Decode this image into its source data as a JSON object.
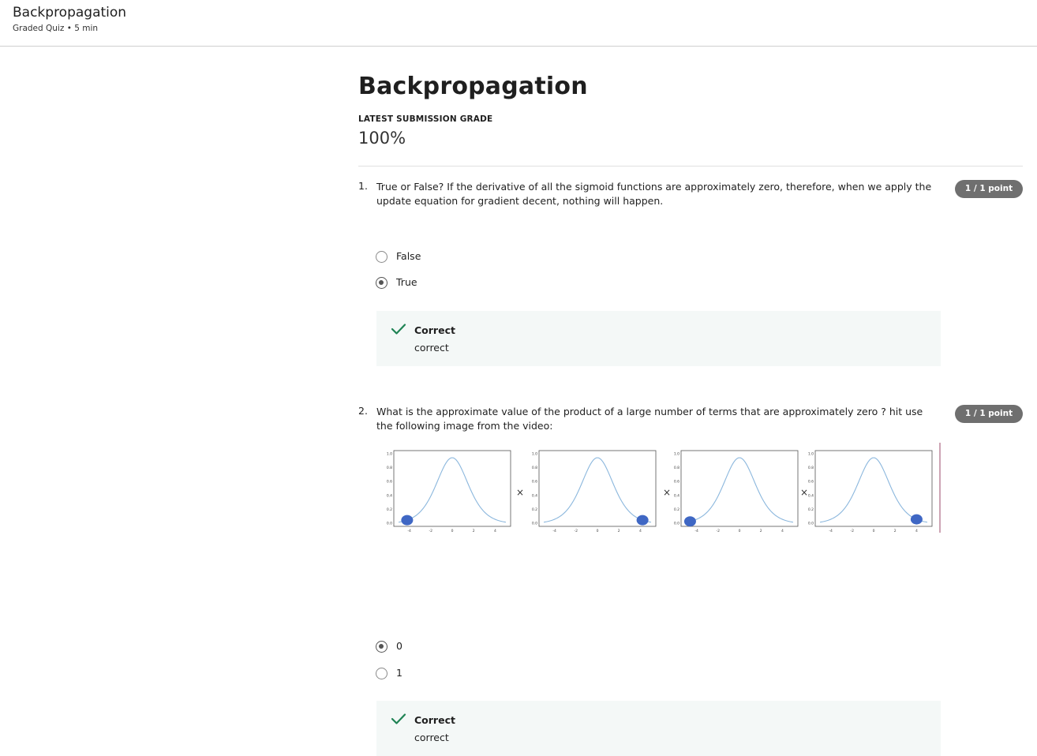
{
  "header": {
    "title": "Backpropagation",
    "subtitle": "Graded Quiz • 5 min"
  },
  "main": {
    "title": "Backpropagation",
    "grade_label": "LATEST SUBMISSION GRADE",
    "grade_value": "100%"
  },
  "questions": [
    {
      "number": "1.",
      "text": "True or False? If the derivative of all the sigmoid functions are approximately zero, therefore, when we apply the update equation for gradient decent, nothing will happen.",
      "points": "1 / 1 point",
      "options": [
        {
          "label": "False",
          "selected": false
        },
        {
          "label": "True",
          "selected": true
        }
      ],
      "feedback": {
        "title": "Correct",
        "text": "correct"
      }
    },
    {
      "number": "2.",
      "text": "What is the approximate value of the product of a large number of terms that are approximately  zero ? hit use the following image from the video:",
      "points": "1 / 1 point",
      "figure": {
        "multiply_symbol": "×",
        "y_ticks": [
          "1.0",
          "0.8",
          "0.6",
          "0.4",
          "0.2",
          "0.0"
        ],
        "x_ticks": [
          "-4",
          "-2",
          "0",
          "2",
          "4"
        ]
      },
      "options": [
        {
          "label": "0",
          "selected": true
        },
        {
          "label": "1",
          "selected": false
        }
      ],
      "feedback": {
        "title": "Correct",
        "text": "correct"
      }
    }
  ],
  "colors": {
    "points_badge": "#6f6f6f",
    "correct_check": "#1f8354",
    "feedback_bg": "#f4f8f7",
    "curve": "#8bb7dd",
    "dot": "#3f67c4"
  }
}
